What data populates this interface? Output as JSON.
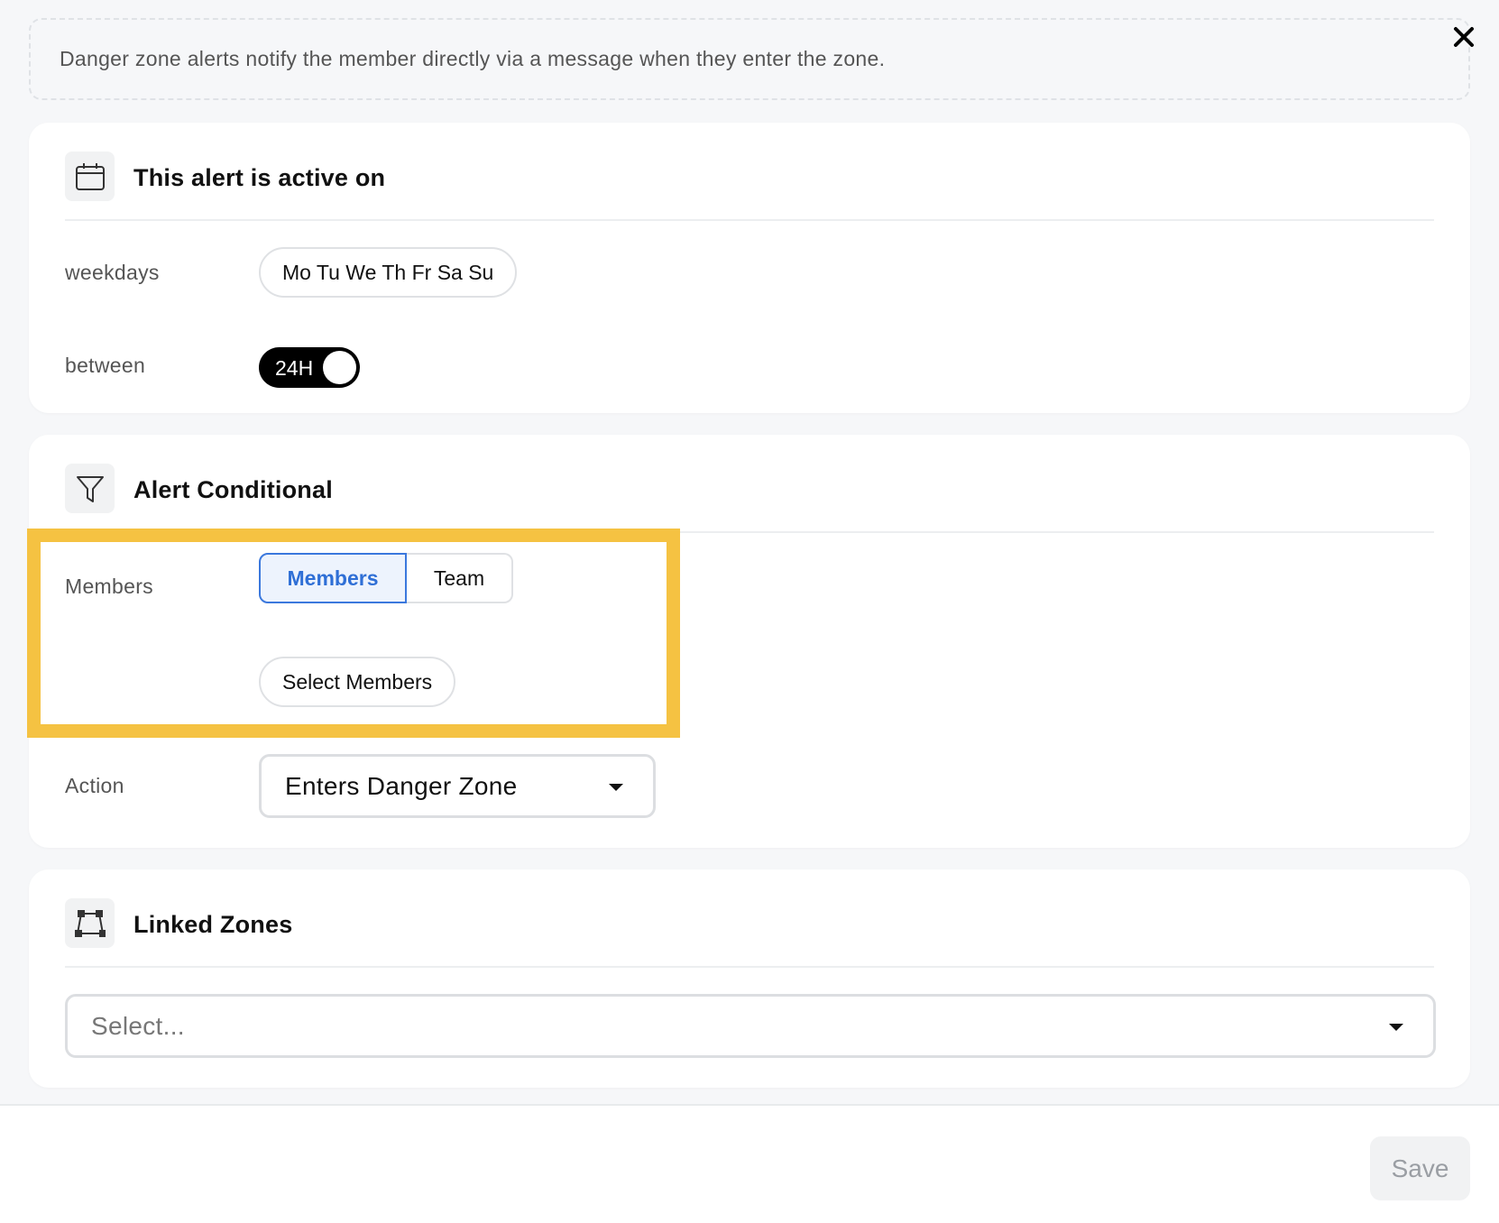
{
  "info": {
    "text": "Danger zone alerts notify the member directly via a message when they enter the zone."
  },
  "close_icon": "close-icon",
  "schedule": {
    "title": "This alert is active on",
    "icon": "calendar-icon",
    "weekdays_label": "weekdays",
    "weekdays_value": "Mo Tu We Th Fr Sa Su",
    "between_label": "between",
    "toggle_label": "24H",
    "toggle_on": true
  },
  "conditional": {
    "title": "Alert Conditional",
    "icon": "filter-icon",
    "members_label": "Members",
    "segments": [
      {
        "label": "Members",
        "active": true
      },
      {
        "label": "Team",
        "active": false
      }
    ],
    "select_members": "Select Members",
    "action_label": "Action",
    "action_value": "Enters Danger Zone"
  },
  "zones": {
    "title": "Linked Zones",
    "icon": "polygon-icon",
    "placeholder": "Select..."
  },
  "footer": {
    "save_label": "Save"
  },
  "colors": {
    "accent": "#3b78dd",
    "highlight": "#f5c242",
    "background": "#f6f7f9"
  }
}
